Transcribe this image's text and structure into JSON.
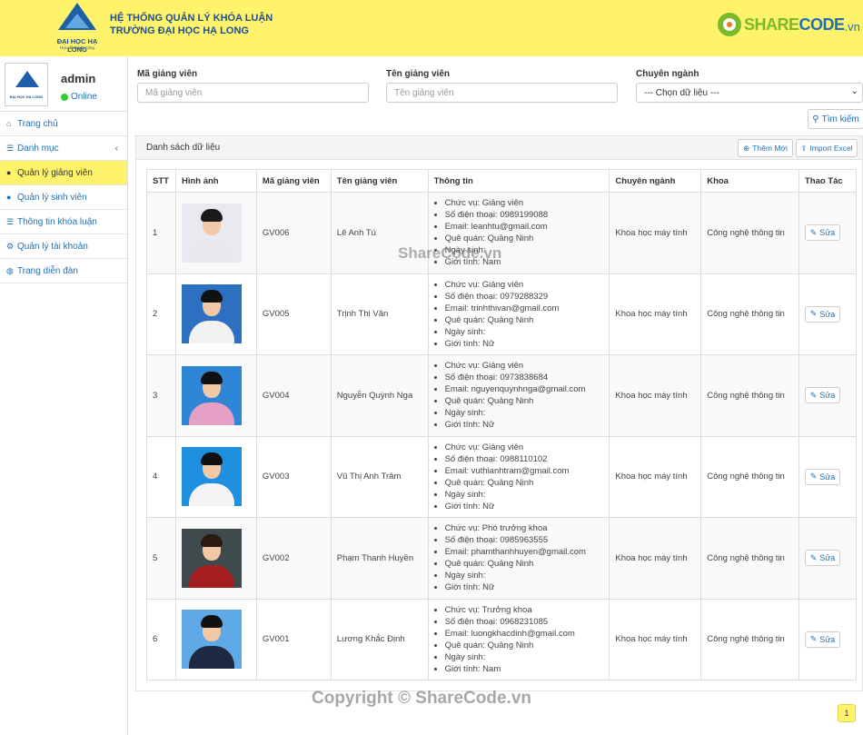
{
  "header": {
    "logo_name": "ĐẠI HỌC HẠ LONG",
    "logo_slogan": "Học để thành công",
    "title_line1": "HỆ THỐNG QUẢN LÝ KHÓA LUẬN",
    "title_line2": "TRƯỜNG ĐẠI HỌC HẠ LONG",
    "brand_share": "SHARE",
    "brand_code": "CODE",
    "brand_vn": ".vn"
  },
  "user": {
    "name": "admin",
    "status": "Online",
    "avatar_text": "ĐẠI HỌC HẠ LONG"
  },
  "menu": [
    {
      "label": "Trang chủ",
      "icon": "home-icon"
    },
    {
      "label": "Danh mục",
      "icon": "list-icon"
    },
    {
      "label": "Quản lý giảng viên",
      "icon": "user-icon"
    },
    {
      "label": "Quản lý sinh viên",
      "icon": "users-icon"
    },
    {
      "label": "Thông tin khóa luận",
      "icon": "list-icon"
    },
    {
      "label": "Quản lý tài khoản",
      "icon": "cogs-icon"
    },
    {
      "label": "Trang diễn đàn",
      "icon": "globe-icon"
    }
  ],
  "filters": {
    "code_label": "Mã giảng viên",
    "code_placeholder": "Mã giảng viên",
    "name_label": "Tên giảng viên",
    "name_placeholder": "Tên giảng viên",
    "major_label": "Chuyên ngành",
    "major_value": "--- Chọn dữ liệu ---",
    "search_label": "Tìm kiếm"
  },
  "panel": {
    "title": "Danh sách dữ liệu",
    "add_label": "Thêm Mới",
    "import_label": "Import Excel"
  },
  "table": {
    "headers": [
      "STT",
      "Hình ảnh",
      "Mã giảng viên",
      "Tên giảng viên",
      "Thông tin",
      "Chuyên ngành",
      "Khoa",
      "Thao Tác"
    ],
    "edit_label": "Sửa",
    "rows": [
      {
        "stt": "1",
        "code": "GV006",
        "name": "Lê Anh Tú",
        "info": [
          "Chức vụ: Giảng viên",
          "Số điện thoại: 0989199088",
          "Email: leanhtu@gmail.com",
          "Quê quán: Quảng Ninh",
          "Ngày sinh:",
          "Giới tính: Nam"
        ],
        "major": "Khoa học máy tính",
        "faculty": "Công nghệ thông tin"
      },
      {
        "stt": "2",
        "code": "GV005",
        "name": "Trịnh Thị Vân",
        "info": [
          "Chức vụ: Giảng viên",
          "Số điện thoại: 0979288329",
          "Email: trinhthivan@gmail.com",
          "Quê quán: Quảng Ninh",
          "Ngày sinh:",
          "Giới tính: Nữ"
        ],
        "major": "Khoa học máy tính",
        "faculty": "Công nghệ thông tin"
      },
      {
        "stt": "3",
        "code": "GV004",
        "name": "Nguyễn Quỳnh Nga",
        "info": [
          "Chức vụ: Giảng viên",
          "Số điện thoại: 0973838684",
          "Email: nguyenquynhnga@gmail.com",
          "Quê quán: Quảng Ninh",
          "Ngày sinh:",
          "Giới tính: Nữ"
        ],
        "major": "Khoa học máy tính",
        "faculty": "Công nghệ thông tin"
      },
      {
        "stt": "4",
        "code": "GV003",
        "name": "Vũ Thị Anh Trâm",
        "info": [
          "Chức vụ: Giảng viên",
          "Số điện thoại: 0988110102",
          "Email: vuthianhtram@gmail.com",
          "Quê quán: Quảng Ninh",
          "Ngày sinh:",
          "Giới tính: Nữ"
        ],
        "major": "Khoa học máy tính",
        "faculty": "Công nghệ thông tin"
      },
      {
        "stt": "5",
        "code": "GV002",
        "name": "Phạm Thanh Huyền",
        "info": [
          "Chức vụ: Phó trưởng khoa",
          "Số điện thoại: 0985963555",
          "Email: phamthanhhuyen@gmail.com",
          "Quê quán: Quảng Ninh",
          "Ngày sinh:",
          "Giới tính: Nữ"
        ],
        "major": "Khoa học máy tính",
        "faculty": "Công nghệ thông tin"
      },
      {
        "stt": "6",
        "code": "GV001",
        "name": "Lương Khắc Định",
        "info": [
          "Chức vụ: Trưởng khoa",
          "Số điện thoại: 0968231085",
          "Email: luongkhacdinh@gmail.com",
          "Quê quán: Quảng Ninh",
          "Ngày sinh:",
          "Giới tính: Nam"
        ],
        "major": "Khoa học máy tính",
        "faculty": "Công nghệ thông tin"
      }
    ]
  },
  "watermark": "ShareCode.vn",
  "copyright": "Copyright © ShareCode.vn",
  "pagination": {
    "current_page": "1"
  },
  "colors": {
    "accent": "#fff36b",
    "link": "#1f6fb4",
    "brand_green": "#7ab929"
  }
}
